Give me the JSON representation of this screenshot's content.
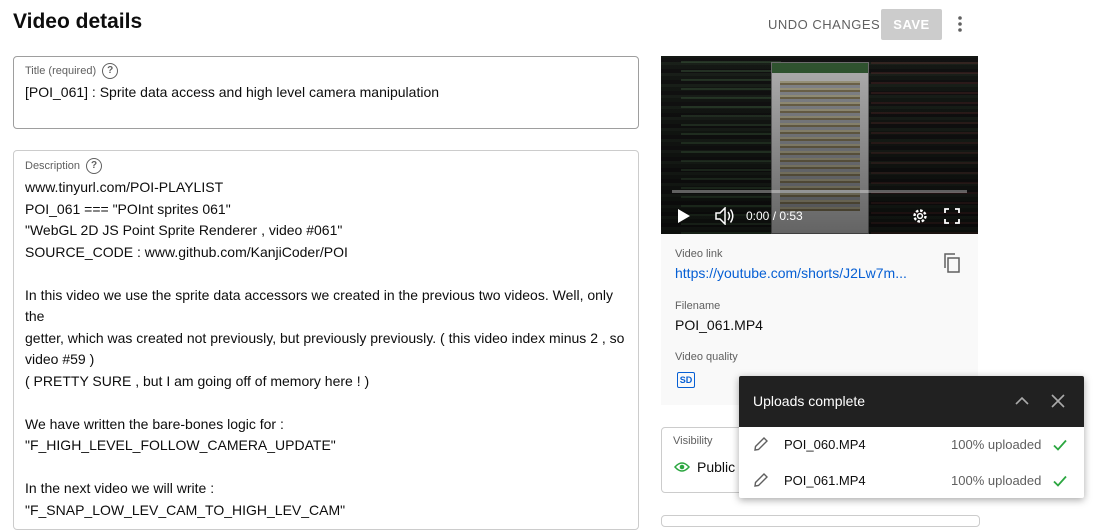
{
  "header": {
    "title": "Video details",
    "undo_label": "UNDO CHANGES",
    "save_label": "SAVE"
  },
  "title_field": {
    "label": "Title (required)",
    "value": "[POI_061] : Sprite data access and high level camera manipulation"
  },
  "description_field": {
    "label": "Description",
    "lines": [
      "www.tinyurl.com/POI-PLAYLIST",
      "POI_061 === \"POInt sprites 061\"",
      "\"WebGL 2D JS Point Sprite Renderer , video #061\"",
      "SOURCE_CODE : www.github.com/KanjiCoder/POI",
      "",
      "In this video we use the sprite data accessors we created in the previous two videos. Well, only the",
      "getter, which was created not previously, but previously previously. ( this video index minus 2 , so",
      "video #59 )",
      "( PRETTY SURE , but I am going off of memory here ! )",
      "",
      "We have written the bare-bones logic for :",
      "\"F_HIGH_LEVEL_FOLLOW_CAMERA_UPDATE\"",
      "",
      "In the next video we will write :",
      "\"F_SNAP_LOW_LEV_CAM_TO_HIGH_LEV_CAM\""
    ]
  },
  "player": {
    "time_display": "0:00 / 0:53",
    "progress_fraction": 0
  },
  "video_info": {
    "link_label": "Video link",
    "link_value": "https://youtube.com/shorts/J2Lw7m...",
    "filename_label": "Filename",
    "filename_value": "POI_061.MP4",
    "quality_label": "Video quality",
    "quality_badge": "SD"
  },
  "visibility": {
    "label": "Visibility",
    "value": "Public"
  },
  "uploads_panel": {
    "title": "Uploads complete",
    "items": [
      {
        "name": "POI_060.MP4",
        "status": "100% uploaded"
      },
      {
        "name": "POI_061.MP4",
        "status": "100% uploaded"
      }
    ]
  },
  "colors": {
    "accent_link": "#065fd4",
    "check_green": "#2ba640",
    "uploads_header_bg": "#212121",
    "save_disabled_bg": "#cccccc"
  },
  "icons": {
    "more": "more-vert-icon",
    "help": "help-icon",
    "copy": "copy-icon",
    "play": "play-icon",
    "volume": "volume-icon",
    "settings": "gear-icon",
    "fullscreen": "fullscreen-icon",
    "eye": "eye-icon",
    "edit": "pencil-icon",
    "check": "check-icon",
    "collapse": "chevron-up-icon",
    "close": "close-icon"
  }
}
